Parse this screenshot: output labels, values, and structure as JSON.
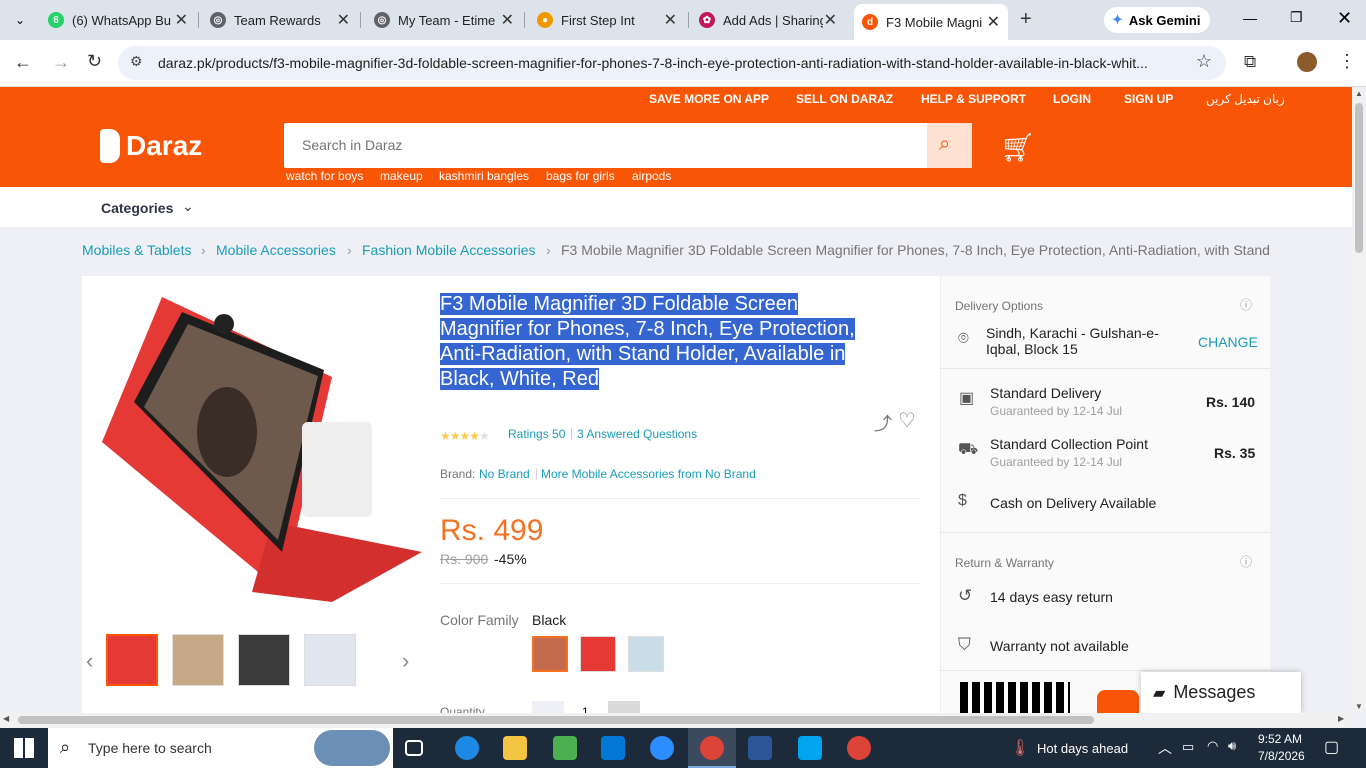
{
  "browser": {
    "tabs": [
      {
        "title": "(6) WhatsApp Bu",
        "favicon": "whatsapp-icon",
        "color": "#25d366"
      },
      {
        "title": "Team Rewards",
        "favicon": "globe-icon",
        "color": "#5f6368"
      },
      {
        "title": "My Team - Etime",
        "favicon": "globe-icon",
        "color": "#5f6368"
      },
      {
        "title": "First Step Int",
        "favicon": "firststep-icon",
        "color": "#f29900"
      },
      {
        "title": "Add Ads | Sharing",
        "favicon": "gear-icon",
        "color": "#c2185b"
      },
      {
        "title": "F3 Mobile Magni",
        "favicon": "daraz-icon",
        "color": "#f85606"
      }
    ],
    "gemini": "Ask Gemini",
    "url": "daraz.pk/products/f3-mobile-magnifier-3d-foldable-screen-magnifier-for-phones-7-8-inch-eye-protection-anti-radiation-with-stand-holder-available-in-black-whit..."
  },
  "header": {
    "links": [
      "SAVE MORE ON APP",
      "SELL ON DARAZ",
      "HELP & SUPPORT",
      "LOGIN",
      "SIGN UP",
      "زبان تبدیل کریں"
    ],
    "logo": "Daraz",
    "search_placeholder": "Search in Daraz",
    "keywords": [
      "watch for boys",
      "makeup",
      "kashmiri bangles",
      "bags for girls",
      "airpods"
    ],
    "categories": "Categories"
  },
  "breadcrumb": [
    "Mobiles & Tablets",
    "Mobile Accessories",
    "Fashion Mobile Accessories",
    "F3 Mobile Magnifier 3D Foldable Screen Magnifier for Phones, 7-8 Inch, Eye Protection, Anti-Radiation, with Stand"
  ],
  "product": {
    "title_lines": [
      "F3 Mobile Magnifier 3D Foldable Screen",
      "Magnifier for Phones, 7-8 Inch, Eye Protection,",
      "Anti-Radiation, with Stand Holder, Available in",
      "Black, White, Red"
    ],
    "ratings": "Ratings 50",
    "rating_value": 4.5,
    "questions": "3 Answered Questions",
    "brand_label": "Brand:",
    "brand": "No Brand",
    "more_from": "More Mobile Accessories from No Brand",
    "price": "Rs. 499",
    "old_price": "Rs. 900",
    "discount": "-45%",
    "color_label": "Color Family",
    "color_value": "Black",
    "quantity_label": "Quantity",
    "quantity": "1"
  },
  "delivery": {
    "title": "Delivery Options",
    "location": "Sindh, Karachi - Gulshan-e-Iqbal, Block 15",
    "change": "CHANGE",
    "options": [
      {
        "name": "Standard Delivery",
        "sub": "Guaranteed by 12-14 Jul",
        "price": "Rs. 140"
      },
      {
        "name": "Standard Collection Point",
        "sub": "Guaranteed by 12-14 Jul",
        "price": "Rs. 35"
      }
    ],
    "cod": "Cash on Delivery Available",
    "return_title": "Return & Warranty",
    "return": "14 days easy return",
    "warranty": "Warranty not available",
    "messages": "Messages"
  },
  "taskbar": {
    "search": "Type here to search",
    "weather": "Hot days ahead",
    "time": "9:52 AM",
    "date": "7/8/2026"
  }
}
